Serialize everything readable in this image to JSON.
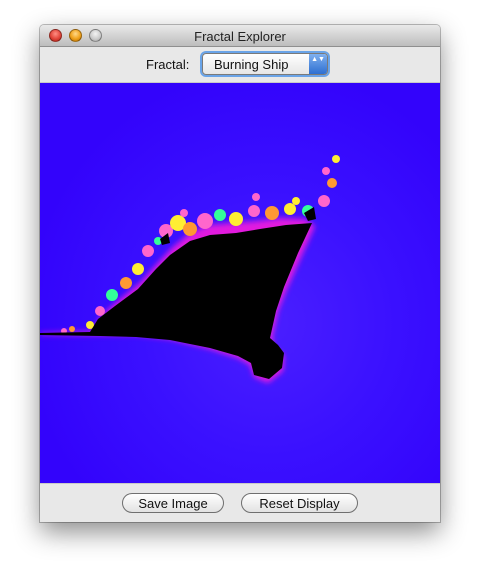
{
  "window": {
    "title": "Fractal Explorer"
  },
  "toolbar": {
    "fractal_label": "Fractal:",
    "fractal_select": {
      "selected": "Burning Ship",
      "arrows": "▲▼"
    }
  },
  "canvas": {
    "fractal": "burning-ship",
    "background_color": "#3a10ff",
    "set_color": "#000000",
    "edge_colors": [
      "#ff1ad9",
      "#ff66cc",
      "#ffee33",
      "#33ff99",
      "#ff9933"
    ]
  },
  "actions": {
    "save_label": "Save Image",
    "reset_label": "Reset Display"
  }
}
